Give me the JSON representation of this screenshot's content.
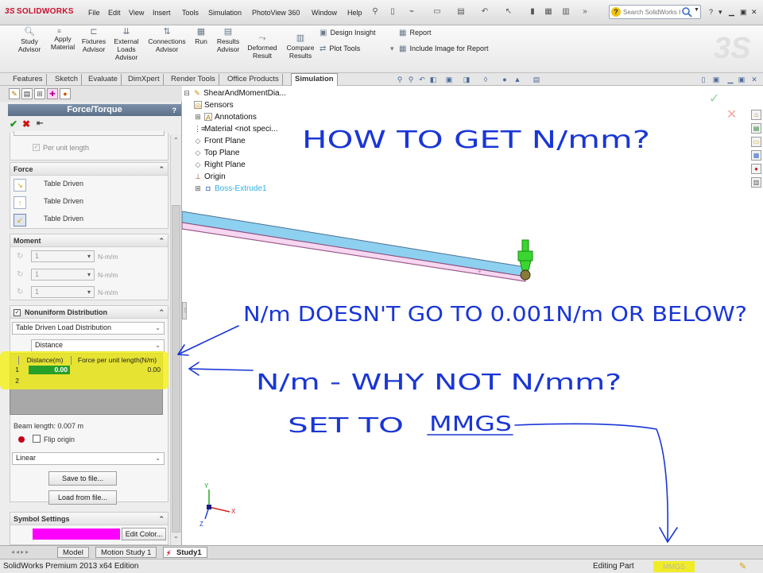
{
  "app": {
    "brand": "SOLIDWORKS",
    "brand_prefix": "3S",
    "colors": {
      "brand": "#c8102e",
      "ink": "#1a36d6",
      "highlight": "#f4f01a",
      "beam_top": "#8ed0f0",
      "beam_side": "#f6d6f0",
      "symbol_color": "#ff00ff"
    }
  },
  "menu": {
    "items": [
      "File",
      "Edit",
      "View",
      "Insert",
      "Tools",
      "Simulation",
      "PhotoView 360",
      "Window",
      "Help"
    ]
  },
  "search": {
    "placeholder": "Search SolidWorks Help"
  },
  "ribbon": {
    "study_advisor": [
      "Study",
      "Advisor"
    ],
    "apply_material": [
      "Apply",
      "Material"
    ],
    "fixtures_advisor": [
      "Fixtures",
      "Advisor"
    ],
    "external_loads": [
      "External",
      "Loads",
      "Advisor"
    ],
    "connections": [
      "Connections",
      "Advisor"
    ],
    "run": "Run",
    "results_advisor": [
      "Results",
      "Advisor"
    ],
    "deformed_result": [
      "Deformed",
      "Result"
    ],
    "compare_results": [
      "Compare",
      "Results"
    ],
    "design_insight": "Design Insight",
    "plot_tools": "Plot Tools",
    "report": "Report",
    "include_image": "Include Image for Report"
  },
  "tabs": [
    "Features",
    "Sketch",
    "Evaluate",
    "DimXpert",
    "Render Tools",
    "Office Products",
    "Simulation"
  ],
  "pm": {
    "title": "Force/Torque",
    "help": "?",
    "per_unit_length": "Per unit length",
    "force": {
      "header": "Force",
      "rows": [
        "Table Driven",
        "Table Driven",
        "Table Driven"
      ]
    },
    "moment": {
      "header": "Moment",
      "rows": [
        {
          "value": "1",
          "unit": "N-m/m"
        },
        {
          "value": "1",
          "unit": "N-m/m"
        },
        {
          "value": "1",
          "unit": "N-m/m"
        }
      ]
    },
    "nonuniform": {
      "header": "Nonuniform Distribution",
      "mode": "Table Driven Load Distribution",
      "basis": "Distance"
    },
    "table": {
      "headers": [
        "Distance(m)",
        "Force per unit length(N/m)"
      ],
      "rows": [
        {
          "num": "1",
          "dist": "0.00",
          "force": "0.00"
        },
        {
          "num": "2",
          "dist": "",
          "force": ""
        }
      ]
    },
    "beam_length": "Beam length: 0.007 m",
    "flip_origin": "Flip origin",
    "interpolation": "Linear",
    "save_to_file": "Save to file...",
    "load_from_file": "Load from file...",
    "symbol": {
      "header": "Symbol Settings",
      "edit_color": "Edit Color..."
    }
  },
  "tree": {
    "items": [
      "ShearAndMomentDia...",
      "Sensors",
      "Annotations",
      "Material <not speci...",
      "Front Plane",
      "Top Plane",
      "Right Plane",
      "Origin",
      "Boss-Extrude1"
    ]
  },
  "triad": {
    "x": "X",
    "y": "Y",
    "z": "Z"
  },
  "annotations": {
    "q1": "HOW TO GET N/mm?",
    "q2": "N/m DOESN'T GO TO 0.001N/m OR BELOW?",
    "q3": "N/m - WHY NOT N/mm?",
    "q4_prefix": "SET TO",
    "q4_units": "MMGS"
  },
  "bottom_tabs": [
    "Model",
    "Motion Study 1",
    "Study1"
  ],
  "status": {
    "edition": "SolidWorks Premium 2013 x64 Edition",
    "editing": "Editing Part",
    "units": "MMGS"
  }
}
